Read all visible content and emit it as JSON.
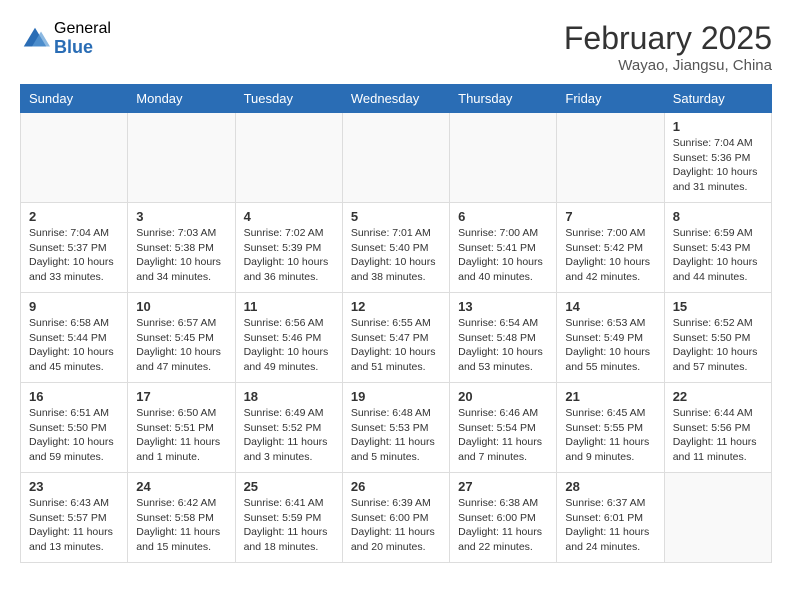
{
  "header": {
    "logo_general": "General",
    "logo_blue": "Blue",
    "month_title": "February 2025",
    "location": "Wayao, Jiangsu, China"
  },
  "weekdays": [
    "Sunday",
    "Monday",
    "Tuesday",
    "Wednesday",
    "Thursday",
    "Friday",
    "Saturday"
  ],
  "weeks": [
    [
      {
        "day": "",
        "info": ""
      },
      {
        "day": "",
        "info": ""
      },
      {
        "day": "",
        "info": ""
      },
      {
        "day": "",
        "info": ""
      },
      {
        "day": "",
        "info": ""
      },
      {
        "day": "",
        "info": ""
      },
      {
        "day": "1",
        "info": "Sunrise: 7:04 AM\nSunset: 5:36 PM\nDaylight: 10 hours\nand 31 minutes."
      }
    ],
    [
      {
        "day": "2",
        "info": "Sunrise: 7:04 AM\nSunset: 5:37 PM\nDaylight: 10 hours\nand 33 minutes."
      },
      {
        "day": "3",
        "info": "Sunrise: 7:03 AM\nSunset: 5:38 PM\nDaylight: 10 hours\nand 34 minutes."
      },
      {
        "day": "4",
        "info": "Sunrise: 7:02 AM\nSunset: 5:39 PM\nDaylight: 10 hours\nand 36 minutes."
      },
      {
        "day": "5",
        "info": "Sunrise: 7:01 AM\nSunset: 5:40 PM\nDaylight: 10 hours\nand 38 minutes."
      },
      {
        "day": "6",
        "info": "Sunrise: 7:00 AM\nSunset: 5:41 PM\nDaylight: 10 hours\nand 40 minutes."
      },
      {
        "day": "7",
        "info": "Sunrise: 7:00 AM\nSunset: 5:42 PM\nDaylight: 10 hours\nand 42 minutes."
      },
      {
        "day": "8",
        "info": "Sunrise: 6:59 AM\nSunset: 5:43 PM\nDaylight: 10 hours\nand 44 minutes."
      }
    ],
    [
      {
        "day": "9",
        "info": "Sunrise: 6:58 AM\nSunset: 5:44 PM\nDaylight: 10 hours\nand 45 minutes."
      },
      {
        "day": "10",
        "info": "Sunrise: 6:57 AM\nSunset: 5:45 PM\nDaylight: 10 hours\nand 47 minutes."
      },
      {
        "day": "11",
        "info": "Sunrise: 6:56 AM\nSunset: 5:46 PM\nDaylight: 10 hours\nand 49 minutes."
      },
      {
        "day": "12",
        "info": "Sunrise: 6:55 AM\nSunset: 5:47 PM\nDaylight: 10 hours\nand 51 minutes."
      },
      {
        "day": "13",
        "info": "Sunrise: 6:54 AM\nSunset: 5:48 PM\nDaylight: 10 hours\nand 53 minutes."
      },
      {
        "day": "14",
        "info": "Sunrise: 6:53 AM\nSunset: 5:49 PM\nDaylight: 10 hours\nand 55 minutes."
      },
      {
        "day": "15",
        "info": "Sunrise: 6:52 AM\nSunset: 5:50 PM\nDaylight: 10 hours\nand 57 minutes."
      }
    ],
    [
      {
        "day": "16",
        "info": "Sunrise: 6:51 AM\nSunset: 5:50 PM\nDaylight: 10 hours\nand 59 minutes."
      },
      {
        "day": "17",
        "info": "Sunrise: 6:50 AM\nSunset: 5:51 PM\nDaylight: 11 hours\nand 1 minute."
      },
      {
        "day": "18",
        "info": "Sunrise: 6:49 AM\nSunset: 5:52 PM\nDaylight: 11 hours\nand 3 minutes."
      },
      {
        "day": "19",
        "info": "Sunrise: 6:48 AM\nSunset: 5:53 PM\nDaylight: 11 hours\nand 5 minutes."
      },
      {
        "day": "20",
        "info": "Sunrise: 6:46 AM\nSunset: 5:54 PM\nDaylight: 11 hours\nand 7 minutes."
      },
      {
        "day": "21",
        "info": "Sunrise: 6:45 AM\nSunset: 5:55 PM\nDaylight: 11 hours\nand 9 minutes."
      },
      {
        "day": "22",
        "info": "Sunrise: 6:44 AM\nSunset: 5:56 PM\nDaylight: 11 hours\nand 11 minutes."
      }
    ],
    [
      {
        "day": "23",
        "info": "Sunrise: 6:43 AM\nSunset: 5:57 PM\nDaylight: 11 hours\nand 13 minutes."
      },
      {
        "day": "24",
        "info": "Sunrise: 6:42 AM\nSunset: 5:58 PM\nDaylight: 11 hours\nand 15 minutes."
      },
      {
        "day": "25",
        "info": "Sunrise: 6:41 AM\nSunset: 5:59 PM\nDaylight: 11 hours\nand 18 minutes."
      },
      {
        "day": "26",
        "info": "Sunrise: 6:39 AM\nSunset: 6:00 PM\nDaylight: 11 hours\nand 20 minutes."
      },
      {
        "day": "27",
        "info": "Sunrise: 6:38 AM\nSunset: 6:00 PM\nDaylight: 11 hours\nand 22 minutes."
      },
      {
        "day": "28",
        "info": "Sunrise: 6:37 AM\nSunset: 6:01 PM\nDaylight: 11 hours\nand 24 minutes."
      },
      {
        "day": "",
        "info": ""
      }
    ]
  ]
}
